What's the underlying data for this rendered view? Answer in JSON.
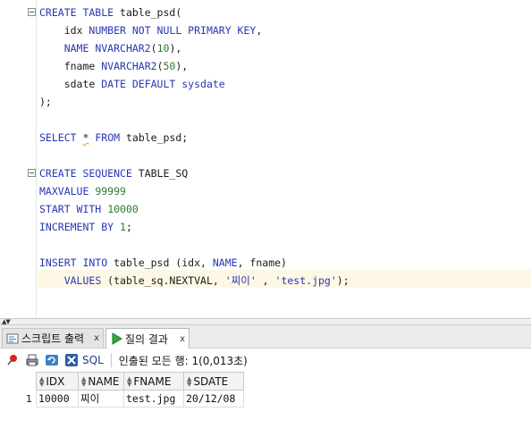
{
  "editor": {
    "lines": [
      [
        {
          "t": "CREATE TABLE",
          "c": "kw"
        },
        {
          "t": " table_psd(",
          "c": ""
        }
      ],
      [
        {
          "t": "    idx ",
          "c": ""
        },
        {
          "t": "NUMBER NOT NULL PRIMARY KEY",
          "c": "kw"
        },
        {
          "t": ",",
          "c": ""
        }
      ],
      [
        {
          "t": "    ",
          "c": ""
        },
        {
          "t": "NAME NVARCHAR2",
          "c": "kw"
        },
        {
          "t": "(",
          "c": ""
        },
        {
          "t": "10",
          "c": "num"
        },
        {
          "t": "),",
          "c": ""
        }
      ],
      [
        {
          "t": "    fname ",
          "c": ""
        },
        {
          "t": "NVARCHAR2",
          "c": "kw"
        },
        {
          "t": "(",
          "c": ""
        },
        {
          "t": "50",
          "c": "num"
        },
        {
          "t": "),",
          "c": ""
        }
      ],
      [
        {
          "t": "    sdate ",
          "c": ""
        },
        {
          "t": "DATE DEFAULT sysdate",
          "c": "kw"
        }
      ],
      [
        {
          "t": ");",
          "c": ""
        }
      ],
      [],
      [
        {
          "t": "SELECT",
          "c": "kw"
        },
        {
          "t": " ",
          "c": ""
        },
        {
          "t": "*",
          "c": "wave"
        },
        {
          "t": " ",
          "c": ""
        },
        {
          "t": "FROM",
          "c": "kw"
        },
        {
          "t": " table_psd;",
          "c": ""
        }
      ],
      [],
      [
        {
          "t": "CREATE SEQUENCE",
          "c": "kw"
        },
        {
          "t": " TABLE_SQ",
          "c": ""
        }
      ],
      [
        {
          "t": "MAXVALUE",
          "c": "kw"
        },
        {
          "t": " ",
          "c": ""
        },
        {
          "t": "99999",
          "c": "num"
        }
      ],
      [
        {
          "t": "START WITH",
          "c": "kw"
        },
        {
          "t": " ",
          "c": ""
        },
        {
          "t": "10000",
          "c": "num"
        }
      ],
      [
        {
          "t": "INCREMENT BY",
          "c": "kw"
        },
        {
          "t": " ",
          "c": ""
        },
        {
          "t": "1",
          "c": "num"
        },
        {
          "t": ";",
          "c": ""
        }
      ],
      [],
      [
        {
          "t": "INSERT INTO",
          "c": "kw"
        },
        {
          "t": " table_psd (idx, ",
          "c": ""
        },
        {
          "t": "NAME",
          "c": "kw"
        },
        {
          "t": ", fname)",
          "c": ""
        }
      ],
      [
        {
          "t": "    ",
          "c": ""
        },
        {
          "t": "VALUES",
          "c": "kw"
        },
        {
          "t": " (table_sq.NEXTVAL, ",
          "c": ""
        },
        {
          "t": "'찌이'",
          "c": "str"
        },
        {
          "t": " , ",
          "c": ""
        },
        {
          "t": "'test.jpg'",
          "c": "str"
        },
        {
          "t": ");",
          "c": ""
        }
      ]
    ]
  },
  "tabs": [
    {
      "label": "스크립트 출력",
      "close": "x",
      "icon": "script-output-icon",
      "active": false
    },
    {
      "label": "질의 결과",
      "close": "x",
      "icon": "run-query-icon",
      "active": true
    }
  ],
  "toolbar": {
    "sql_label": "SQL",
    "status": "인출된 모든 행: 1(0,013초)"
  },
  "results": {
    "columns": [
      "IDX",
      "NAME",
      "FNAME",
      "SDATE"
    ],
    "rows": [
      {
        "num": "1",
        "cells": [
          "10000",
          "찌이",
          "test.jpg",
          "20/12/08"
        ]
      }
    ]
  },
  "colors": {
    "keyword": "#2a36b1",
    "number": "#2f7a2f",
    "current_line": "#fdf8e6"
  }
}
